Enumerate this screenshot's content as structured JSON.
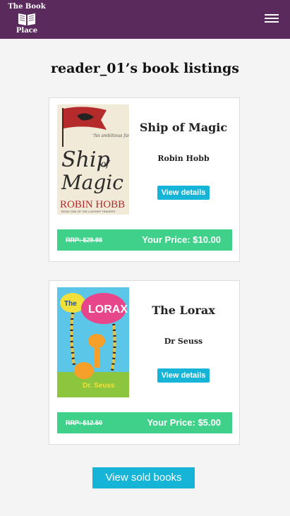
{
  "navbar": {
    "brand_line1": "The Book",
    "brand_line2": "Place",
    "menu_icon": "hamburger-menu-icon"
  },
  "page_title": "reader_01’s book listings",
  "listings": [
    {
      "title": "Ship of Magic",
      "author": "Robin Hobb",
      "details_label": "View details",
      "rrp": "RRP: $29.98",
      "price": "Your Price: $10.00",
      "cover_text": "Ship of Magic",
      "cover_author": "ROBIN HOBB"
    },
    {
      "title": "The Lorax",
      "author": "Dr Seuss",
      "details_label": "View details",
      "rrp": "RRP: $12.50",
      "price": "Your Price: $5.00",
      "cover_text": "The LORAX",
      "cover_author": "Dr. Seuss"
    }
  ],
  "sold_button_label": "View sold books",
  "colors": {
    "navbar": "#5a2a5c",
    "button": "#16b4d6",
    "price_bar": "#3fd18a"
  }
}
